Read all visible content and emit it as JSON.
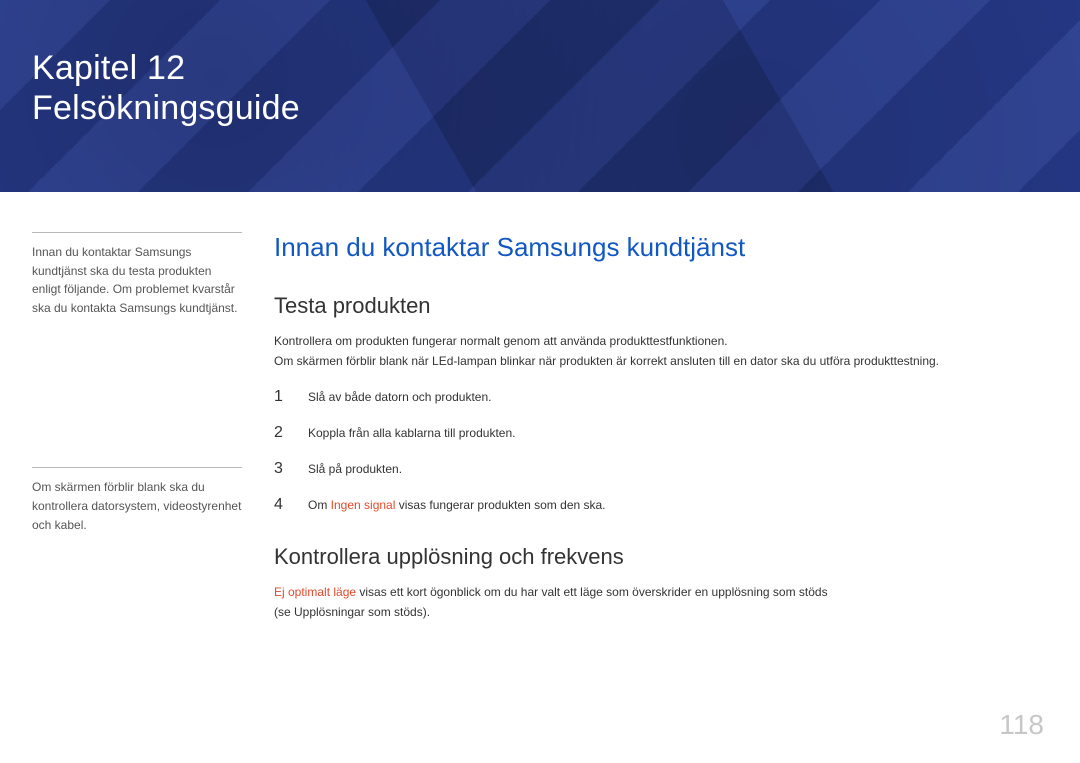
{
  "banner": {
    "chapter_line": "Kapitel 12",
    "title_line": "Felsökningsguide"
  },
  "sidebar": {
    "note1": "Innan du kontaktar Samsungs kundtjänst ska du testa produkten enligt följande. Om problemet kvarstår ska du kontakta Samsungs kundtjänst.",
    "note2": "Om skärmen förblir blank ska du kontrollera datorsystem, videostyrenhet och kabel."
  },
  "main": {
    "section_title": "Innan du kontaktar Samsungs kundtjänst",
    "h3_test": "Testa produkten",
    "test_p1": "Kontrollera om produkten fungerar normalt genom att använda produkttestfunktionen.",
    "test_p2": "Om skärmen förblir blank när LEd-lampan blinkar när produkten är korrekt ansluten till en dator ska du utföra produkttestning.",
    "steps": {
      "s1": "Slå av både datorn och produkten.",
      "s2": "Koppla från alla kablarna till produkten.",
      "s3": "Slå på produkten.",
      "s4_pre": "Om ",
      "s4_highlight": "Ingen signal",
      "s4_post": " visas fungerar produkten som den ska."
    },
    "h3_res": "Kontrollera upplösning och frekvens",
    "res_p1_hl": "Ej optimalt läge",
    "res_p1_rest": " visas ett kort ögonblick om du har valt ett läge som överskrider en upplösning som stöds",
    "res_p2": "(se Upplösningar som stöds)."
  },
  "page_number": "118"
}
